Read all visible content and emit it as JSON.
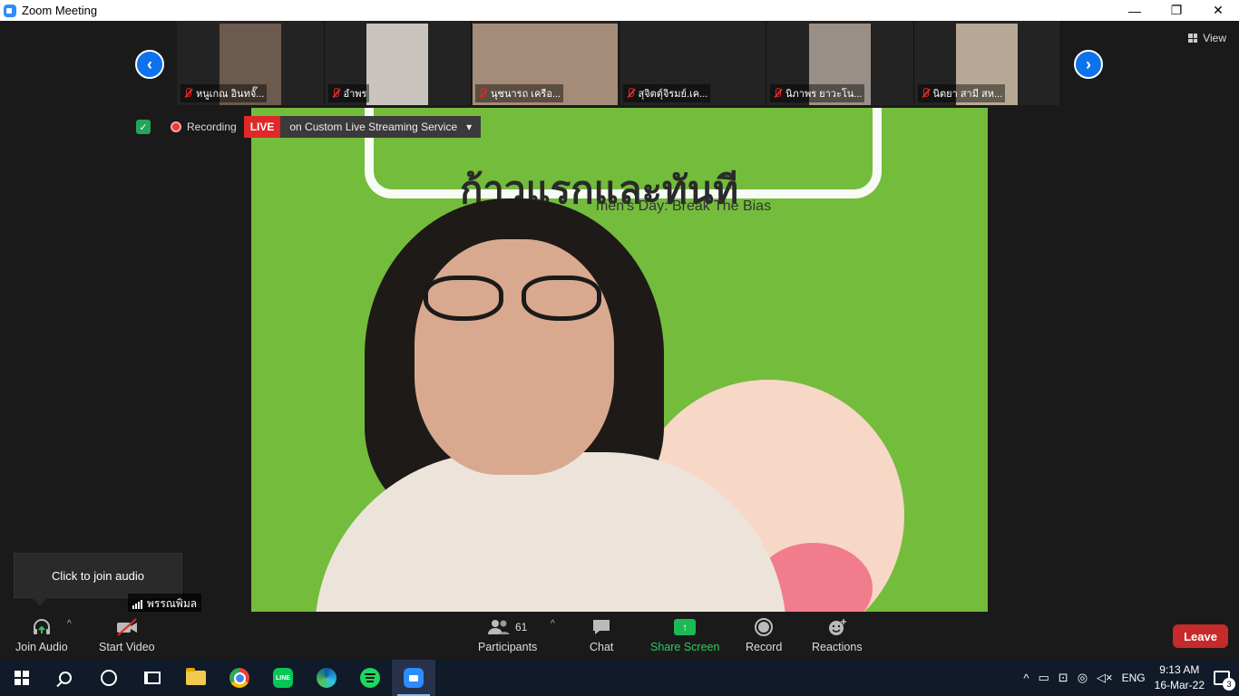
{
  "window": {
    "title": "Zoom Meeting",
    "minimize": "—",
    "restore": "❐",
    "close": "✕"
  },
  "gallery": {
    "prev": "‹",
    "next": "›",
    "view_label": "View",
    "participants": [
      {
        "name": "หนูเกณ อินทจั๊...",
        "cam": "#6b5a4d"
      },
      {
        "name": "อำพร",
        "cam": "#c9c4be"
      },
      {
        "name": "นุชนารถ  เครือ...",
        "cam": "#a58c78"
      },
      {
        "name": "สุจิตต์ุจิรมย์.เค...",
        "cam": "#232323"
      },
      {
        "name": "นิภาพร ยาวะโน...",
        "cam": "#9a8f86"
      },
      {
        "name": "นิตยา สามี สห...",
        "cam": "#b6a894"
      }
    ]
  },
  "status": {
    "shield": "✓",
    "recording_label": "Recording",
    "live_badge": "LIVE",
    "live_service": "on Custom Live Streaming Service",
    "live_caret": "▾"
  },
  "speaker": {
    "bg_thai_text": "ก้าวแรกและทันที",
    "bg_sub_text": "men's Day: Break The Bias",
    "name": "พรรณพิมล"
  },
  "tooltip": {
    "text": "Click to join audio"
  },
  "toolbar": {
    "join_audio": "Join Audio",
    "start_video": "Start Video",
    "participants_label": "Participants",
    "participants_count": "61",
    "chat": "Chat",
    "share_screen": "Share Screen",
    "record": "Record",
    "reactions": "Reactions",
    "leave": "Leave",
    "caret": "^"
  },
  "taskbar": {
    "line_label": "LINE",
    "tray_up": "^",
    "lang": "ENG",
    "time": "9:13 AM",
    "date": "16-Mar-22",
    "notif_count": "3"
  },
  "colors": {
    "accent": "#0e72ed",
    "live": "#e02828",
    "share": "#2ec95f",
    "leave": "#c62a2a",
    "video_bg": "#74bc3c"
  }
}
